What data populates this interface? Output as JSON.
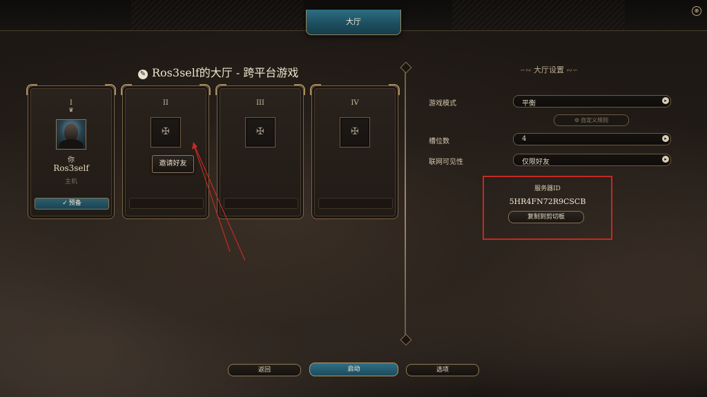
{
  "top_bar": {
    "tab_lobby": "大厅",
    "close_glyph": "⊗"
  },
  "lobby": {
    "title": "Ros3self的大厅 - 跨平台游戏",
    "feather_glyph": "✎"
  },
  "slots": [
    {
      "numeral": "I",
      "crown_glyph": "♛",
      "you_label": "你",
      "player_name": "Ros3self",
      "role": "主机",
      "ready_label": "预备",
      "check_glyph": "✓"
    },
    {
      "numeral": "II",
      "cross_glyph": "✠",
      "invite_label": "邀请好友"
    },
    {
      "numeral": "III",
      "cross_glyph": "✠"
    },
    {
      "numeral": "IV",
      "cross_glyph": "✠"
    }
  ],
  "settings": {
    "title": "大厅设置",
    "flourish_left": "∽∾",
    "flourish_right": "∾∽",
    "game_mode_label": "游戏模式",
    "game_mode_value": "平衡",
    "custom_rules_label": "自定义规则",
    "gear_glyph": "⚙",
    "slots_label": "槽位数",
    "slots_value": "4",
    "visibility_label": "联网可见性",
    "visibility_value": "仅限好友",
    "arrow_glyph": "▸"
  },
  "server": {
    "label": "服务器ID",
    "id": "5HR4FN72R9CSCB",
    "copy_label": "复制到剪切板"
  },
  "bottom": {
    "back_label": "返回",
    "start_label": "启动",
    "options_label": "选项"
  },
  "colors": {
    "accent_teal": "#2c6f83",
    "gold_border": "#9c8458",
    "annotation_red": "#c42a25"
  }
}
